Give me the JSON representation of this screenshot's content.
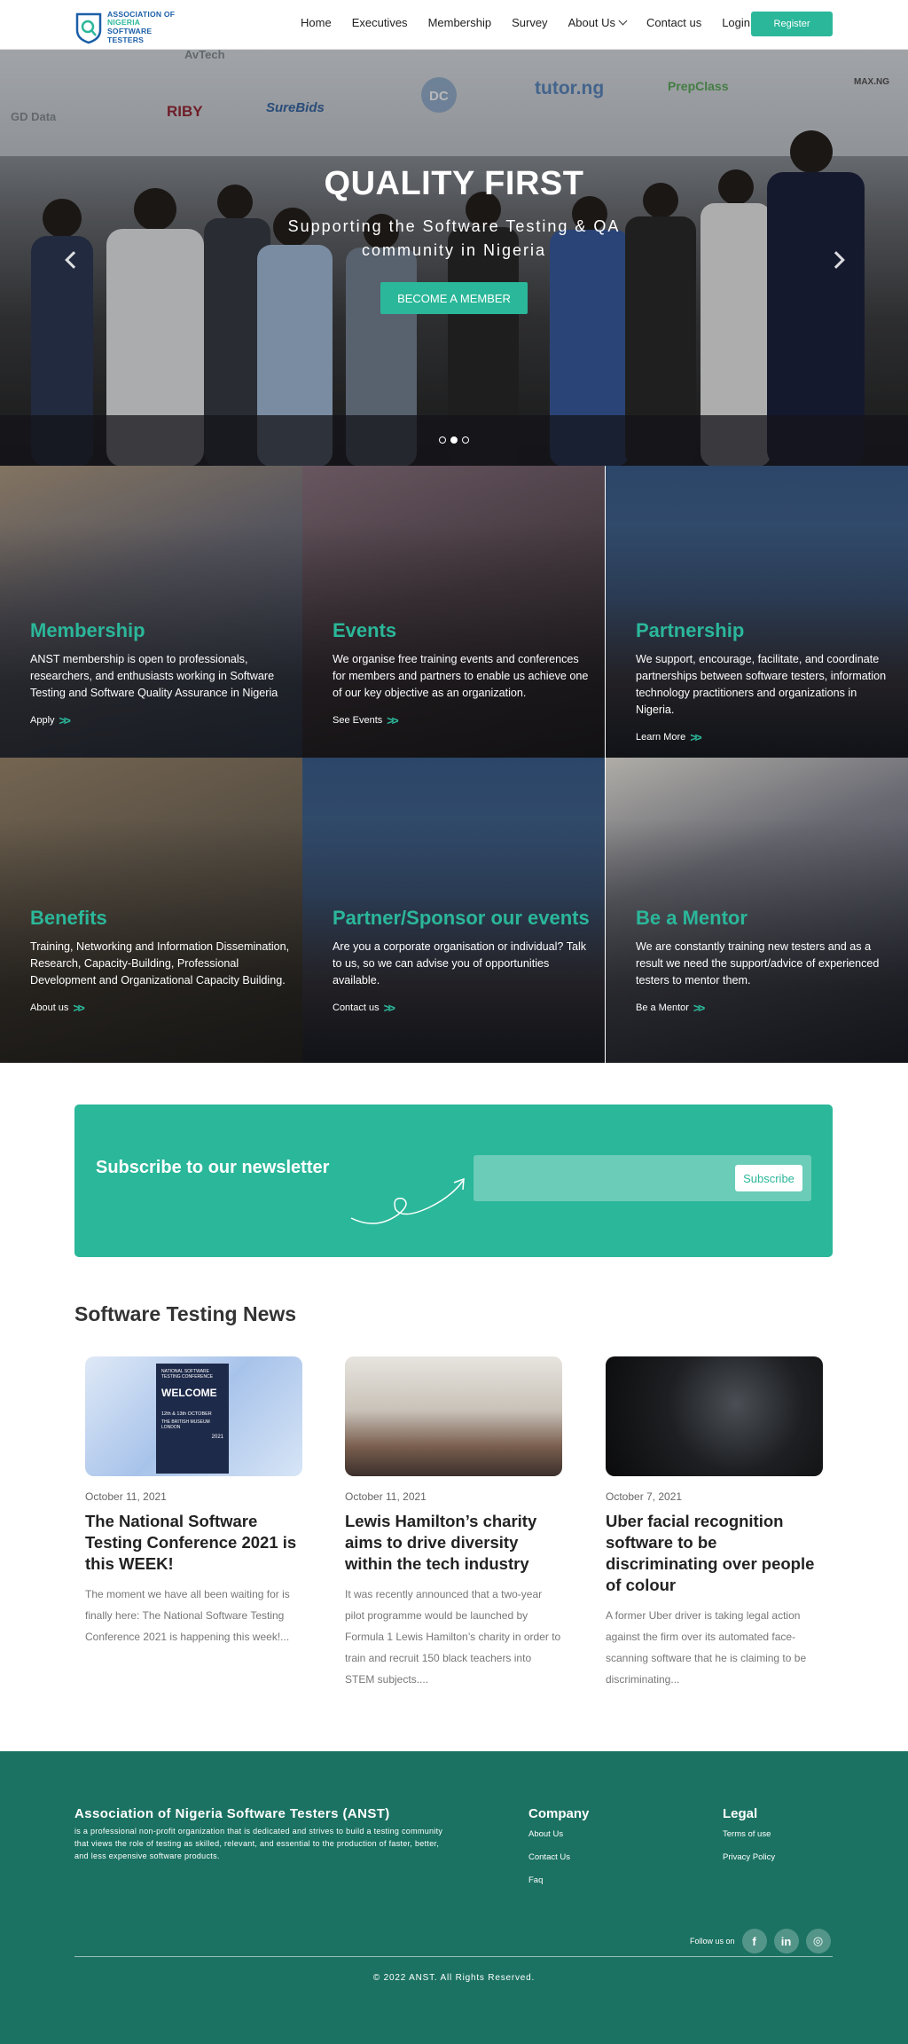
{
  "logo": {
    "line1": "ASSOCIATION OF",
    "line2": "NIGERIA",
    "line3": "SOFTWARE",
    "line4": "TESTERS"
  },
  "nav": {
    "items": [
      "Home",
      "Executives",
      "Membership",
      "Survey",
      "About Us",
      "Contact us",
      "Login"
    ],
    "register": "Register"
  },
  "hero": {
    "title": "QUALITY FIRST",
    "subtitle": "Supporting the Software Testing & QA community in Nigeria",
    "cta": "BECOME A MEMBER",
    "sponsors": [
      "AvTech",
      "GD Data",
      "RIBY",
      "SureBids",
      "DC",
      "tutor.ng",
      "PrepClass",
      "MAX.NG"
    ],
    "slides_total": 3,
    "slide_active": 2
  },
  "cards": [
    {
      "title": "Membership",
      "text": "ANST membership is open to professionals, researchers, and enthusiasts working in Software Testing and Software Quality Assurance in Nigeria",
      "link": "Apply"
    },
    {
      "title": "Events",
      "text": "We organise free training events and conferences for members and partners to enable us achieve one of our key objective as an organization.",
      "link": "See Events"
    },
    {
      "title": "Partnership",
      "text": "We support, encourage, facilitate, and coordinate partnerships between software testers, information technology practitioners and organizations in Nigeria.",
      "link": "Learn More"
    },
    {
      "title": "Benefits",
      "text": "Training, Networking and Information Dissemination, Research, Capacity-Building, Professional Development and Organizational Capacity Building.",
      "link": "About us"
    },
    {
      "title": "Partner/Sponsor our events",
      "text": "Are you a corporate organisation or individual? Talk to us, so we can advise you of opportunities available.",
      "link": "Contact us"
    },
    {
      "title": "Be a Mentor",
      "text": "We are constantly training new testers and as a result we need the support/advice of experienced testers to mentor them.",
      "link": "Be a Mentor"
    }
  ],
  "newsletter": {
    "title": "Subscribe to our newsletter",
    "placeholder": "",
    "button": "Subscribe"
  },
  "news": {
    "heading": "Software Testing News",
    "poster": {
      "brand": "NATIONAL SOFTWARE TESTING CONFERENCE",
      "headline": "WELCOME",
      "dates": "12th & 13th OCTOBER",
      "venue": "THE BRITISH MUSEUM LONDON",
      "year": "2021"
    },
    "items": [
      {
        "date": "October 11, 2021",
        "title": "The National Software Testing Conference 2021 is this WEEK!",
        "excerpt": "The moment we have all been waiting for is finally here: The National Software Testing Conference 2021 is happening this week!..."
      },
      {
        "date": "October 11, 2021",
        "title": "Lewis Hamilton’s charity aims to drive diversity within the tech industry",
        "excerpt": "It was recently announced that a two-year pilot programme would be launched by Formula 1 Lewis Hamilton’s charity in order to train and recruit 150 black teachers into STEM subjects...."
      },
      {
        "date": "October 7, 2021",
        "title": "Uber facial recognition software to be discriminating over people of colour",
        "excerpt": "A former Uber driver is taking legal action against the firm over its automated face-scanning software that he is claiming to be discriminating..."
      }
    ]
  },
  "footer": {
    "org": "Association of Nigeria Software Testers (ANST)",
    "desc": "is a professional non-profit organization that is dedicated and strives to build a testing community that views the role of testing as skilled, relevant, and essential to the production of faster, better, and less expensive software products.",
    "company": {
      "title": "Company",
      "links": [
        "About Us",
        "Contact Us",
        "Faq"
      ]
    },
    "legal": {
      "title": "Legal",
      "links": [
        "Terms of use",
        "Privacy Policy"
      ]
    },
    "follow": "Follow us on",
    "social": [
      "f",
      "in",
      "◎"
    ],
    "copyright": "© 2022 ANST. All Rights Reserved."
  },
  "colors": {
    "accent": "#2bb79a",
    "footer": "#1b7262",
    "brand": "#1b5fa8"
  }
}
